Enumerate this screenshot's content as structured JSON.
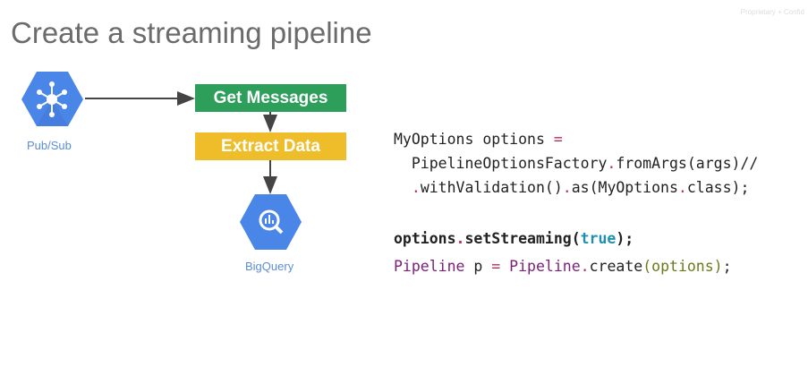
{
  "slide": {
    "title": "Create a streaming pipeline",
    "confidential": "Proprietary + Confid"
  },
  "diagram": {
    "source": {
      "label": "Pub/Sub",
      "icon": "pubsub-icon"
    },
    "steps": [
      {
        "label": "Get Messages",
        "color": "#2e9e5b"
      },
      {
        "label": "Extract Data",
        "color": "#efbd2a"
      }
    ],
    "sink": {
      "label": "BigQuery",
      "icon": "bigquery-icon"
    }
  },
  "code": {
    "l1a": "MyOptions options ",
    "l1b": "=",
    "l2a": "  PipelineOptionsFactory",
    "l2b": ".",
    "l2c": "fromArgs(args)//",
    "l3a": "  ",
    "l3b": ".",
    "l3c": "withValidation()",
    "l3d": ".",
    "l3e": "as(MyOptions",
    "l3f": ".",
    "l3g": "class);",
    "l4a": "options",
    "l4b": ".",
    "l4c": "setStreaming(",
    "l4d": "true",
    "l4e": ");",
    "l5a": "Pipeline",
    "l5b": " p ",
    "l5c": "=",
    "l5d": " ",
    "l5e": "Pipeline",
    "l5f": ".",
    "l5g": "create",
    "l5h": "(options)",
    "l5i": ";"
  }
}
